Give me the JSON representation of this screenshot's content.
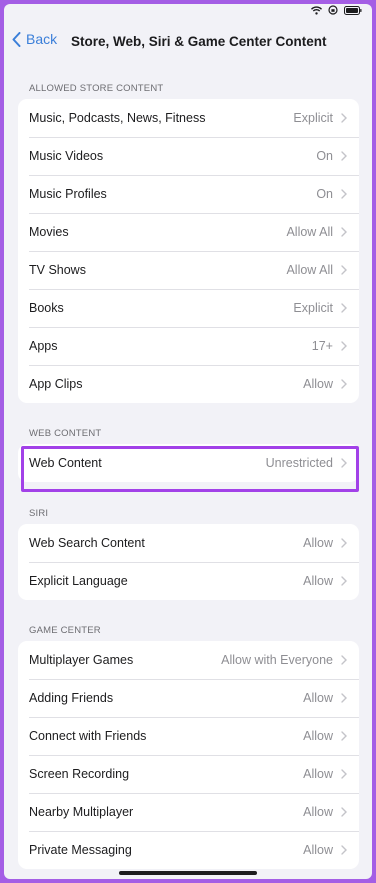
{
  "nav": {
    "back_label": "Back",
    "title": "Store, Web, Siri & Game Center Content"
  },
  "sections": [
    {
      "header": "ALLOWED STORE CONTENT",
      "rows": [
        {
          "label": "Music, Podcasts, News, Fitness",
          "value": "Explicit"
        },
        {
          "label": "Music Videos",
          "value": "On"
        },
        {
          "label": "Music Profiles",
          "value": "On"
        },
        {
          "label": "Movies",
          "value": "Allow All"
        },
        {
          "label": "TV Shows",
          "value": "Allow All"
        },
        {
          "label": "Books",
          "value": "Explicit"
        },
        {
          "label": "Apps",
          "value": "17+"
        },
        {
          "label": "App Clips",
          "value": "Allow"
        }
      ]
    },
    {
      "header": "WEB CONTENT",
      "rows": [
        {
          "label": "Web Content",
          "value": "Unrestricted"
        }
      ]
    },
    {
      "header": "SIRI",
      "rows": [
        {
          "label": "Web Search Content",
          "value": "Allow"
        },
        {
          "label": "Explicit Language",
          "value": "Allow"
        }
      ]
    },
    {
      "header": "GAME CENTER",
      "rows": [
        {
          "label": "Multiplayer Games",
          "value": "Allow with Everyone"
        },
        {
          "label": "Adding Friends",
          "value": "Allow"
        },
        {
          "label": "Connect with Friends",
          "value": "Allow"
        },
        {
          "label": "Screen Recording",
          "value": "Allow"
        },
        {
          "label": "Nearby Multiplayer",
          "value": "Allow"
        },
        {
          "label": "Private Messaging",
          "value": "Allow"
        }
      ]
    }
  ],
  "icons": {
    "status": [
      "wifi-icon",
      "rotation-lock-icon",
      "battery-icon"
    ],
    "back": "chevron-left-icon",
    "row": "chevron-right-icon"
  },
  "colors": {
    "accent": "#3b7fd9",
    "highlight": "#a241e8",
    "frame": "#a45ee5",
    "background": "#f2f2f7"
  }
}
